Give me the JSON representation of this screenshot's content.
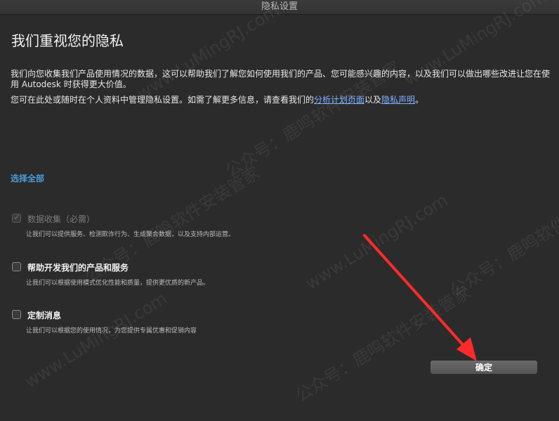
{
  "window": {
    "title": "隐私设置"
  },
  "heading": "我们重视您的隐私",
  "intro": {
    "paragraph1": "我们向您收集我们产品使用情况的数据，这可以帮助我们了解您如何使用我们的产品、您可能感兴趣的内容，以及我们可以做出哪些改进让您在使用 Autodesk 时获得更大价值。",
    "paragraph2_prefix": "您可在此处或随时在个人资料中管理隐私设置。如需了解更多信息，请查看我们的",
    "link_analytics": "分析计划页面",
    "paragraph2_middle": "以及",
    "link_privacy": "隐私声明",
    "paragraph2_suffix": "。"
  },
  "select_all": "选择全部",
  "options": [
    {
      "label": "数据收集（必需）",
      "description": "让我们可以提供服务、检测欺诈行为、生成聚合数据，以及支持内部运营。",
      "checked": true,
      "disabled": true
    },
    {
      "label": "帮助开发我们的产品和服务",
      "description": "让我们可以根据使用模式优化性能和质量，提供更优质的新产品。",
      "checked": false,
      "disabled": false
    },
    {
      "label": "定制消息",
      "description": "让我们可以根据您的使用情况，为您提供专属优惠和促销内容",
      "checked": false,
      "disabled": false
    }
  ],
  "ok_button": "确定",
  "checkmark": "✓",
  "watermarks": [
    "公众号：鹿鸣软件安装管家",
    "www.LuMingRJ.com"
  ],
  "colors": {
    "background": "#2b2b2b",
    "link": "#7fb0ff",
    "select_all": "#4a9bd8",
    "annotation_arrow": "#ff2a2a"
  }
}
